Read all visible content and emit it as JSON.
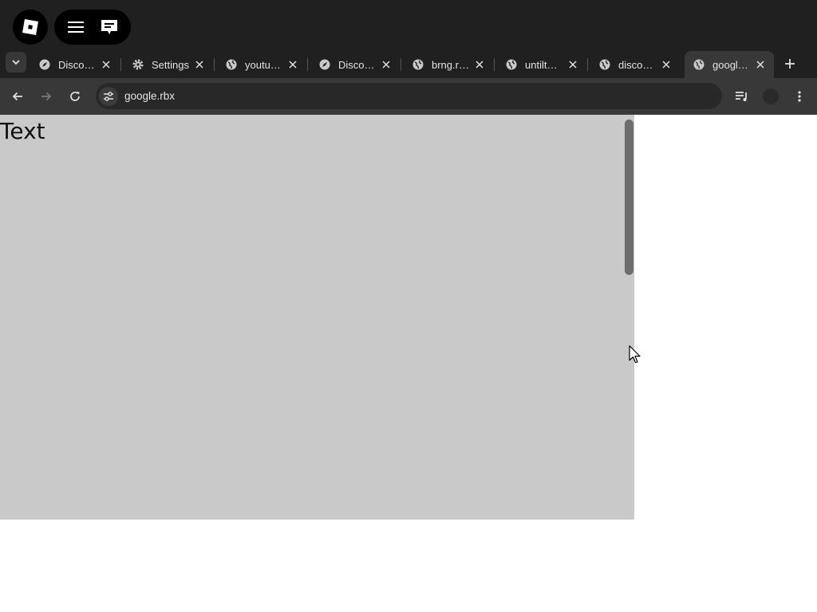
{
  "roblox_menu": {
    "icon": "roblox-logo-icon"
  },
  "top_pill": {
    "menu_icon": "hamburger-menu-icon",
    "chat_icon": "chat-icon"
  },
  "tabs": [
    {
      "title": "Disco…",
      "icon": "compass-icon",
      "active": false
    },
    {
      "title": "Settings",
      "icon": "gear-icon",
      "active": false
    },
    {
      "title": "youtu…",
      "icon": "globe-icon",
      "active": false
    },
    {
      "title": "Disco…",
      "icon": "compass-icon",
      "active": false
    },
    {
      "title": "brng.r…",
      "icon": "globe-icon",
      "active": false
    },
    {
      "title": "untilt…",
      "icon": "globe-icon",
      "active": false
    },
    {
      "title": "discor…",
      "icon": "globe-icon",
      "active": false
    },
    {
      "title": "googl…",
      "icon": "globe-icon",
      "active": true
    }
  ],
  "address_bar": {
    "url": "google.rbx"
  },
  "page": {
    "text": "Text"
  },
  "colors": {
    "chrome_dark": "#202020",
    "toolbar": "#383838",
    "viewport_bg": "#c9c9c9"
  }
}
